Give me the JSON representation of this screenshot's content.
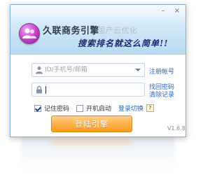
{
  "window": {
    "minimize_glyph": "–",
    "close_glyph": "×"
  },
  "header": {
    "brand_title": "久联商务引擎",
    "brand_subtitle": "国产云优化",
    "slogan": "搜索排名就这么简单!!",
    "logo_icon": "users-icon"
  },
  "login": {
    "account_placeholder": "ID/手机号/邮箱",
    "account_value": "",
    "password_value": "",
    "register_link": "注册帐号",
    "find_password_link": "找回密码",
    "clear_records_link": "清除记录",
    "remember_password": "记住密码",
    "remember_checked": true,
    "auto_start": "开机启动",
    "auto_start_checked": false,
    "mode_switch": "登录切换",
    "help_glyph": "?",
    "login_button": "登陆引擎",
    "version": "V1.6.8"
  },
  "colors": {
    "accent": "#f79a1c",
    "link": "#2a66b8",
    "header_bg": "#cde5f6"
  }
}
